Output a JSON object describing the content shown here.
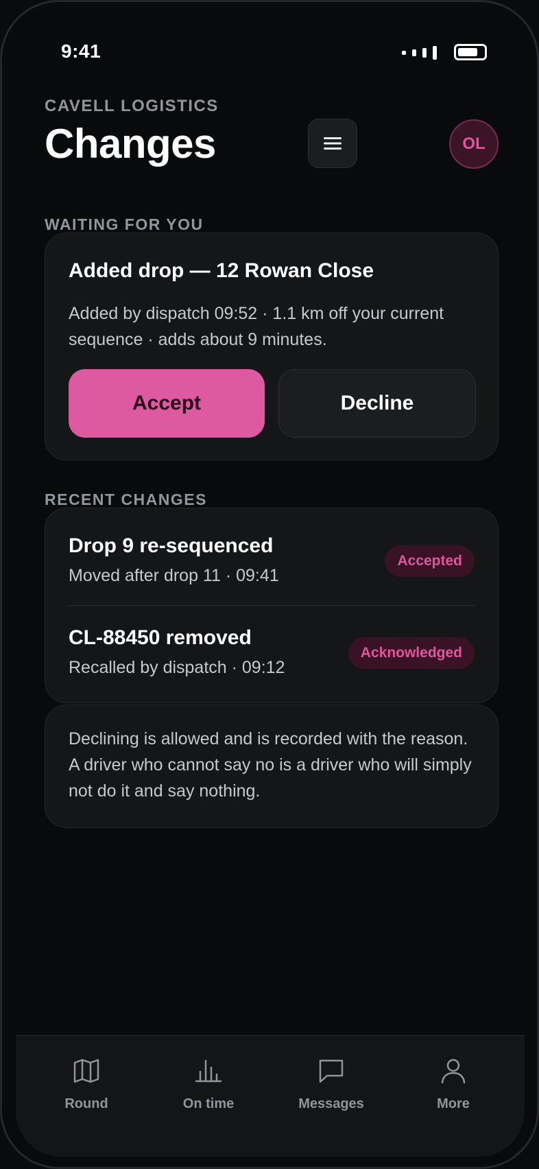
{
  "status_bar": {
    "time": "9:41",
    "icons": [
      "signal-icon",
      "battery-icon"
    ]
  },
  "header": {
    "eyebrow": "CAVELL LOGISTICS",
    "title": "Changes",
    "menu_icon": "hamburger-menu-icon",
    "avatar_initials": "OL"
  },
  "waiting": {
    "section_label": "WAITING FOR YOU",
    "title": "Added drop — 12 Rowan Close",
    "description": "Added by dispatch 09:52 · 1.1 km off your current sequence · adds about 9 minutes.",
    "accept_label": "Accept",
    "decline_label": "Decline"
  },
  "recent": {
    "section_label": "RECENT CHANGES",
    "items": [
      {
        "title": "Drop 9 re-sequenced",
        "subtitle": "Moved after drop 11 · 09:41",
        "badge": "Accepted"
      },
      {
        "title": "CL-88450 removed",
        "subtitle": "Recalled by dispatch · 09:12",
        "badge": "Acknowledged"
      }
    ]
  },
  "note": {
    "text": "Declining is allowed and is recorded with the reason. A driver who cannot say no is a driver who will simply not do it and say nothing."
  },
  "tabbar": {
    "tabs": [
      {
        "label": "Round",
        "icon": "map-icon"
      },
      {
        "label": "On time",
        "icon": "bar-chart-icon"
      },
      {
        "label": "Messages",
        "icon": "message-icon"
      },
      {
        "label": "More",
        "icon": "user-icon"
      }
    ]
  },
  "colors": {
    "accent": "#dd5aa0",
    "background": "#090a0c",
    "card": "#141618",
    "badge_bg": "#3a1226",
    "muted_text": "#8f969c"
  }
}
